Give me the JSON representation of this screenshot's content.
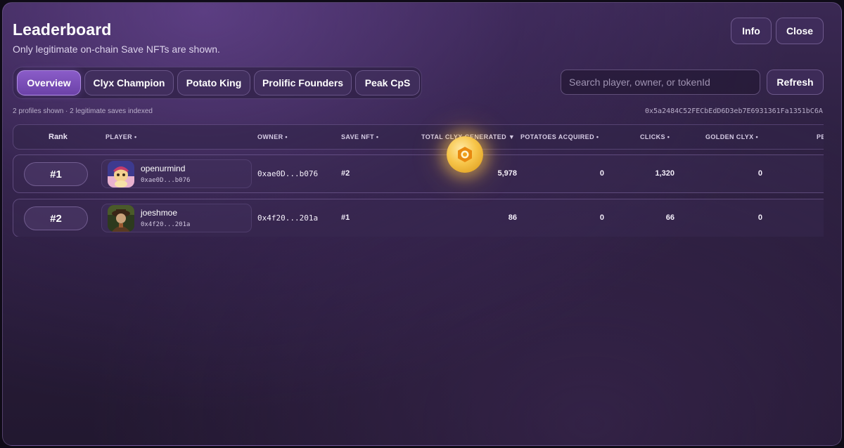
{
  "header": {
    "title": "Leaderboard",
    "subtitle": "Only legitimate on-chain Save NFTs are shown.",
    "info_label": "Info",
    "close_label": "Close"
  },
  "tabs": [
    {
      "label": "Overview",
      "active": true
    },
    {
      "label": "Clyx Champion",
      "active": false
    },
    {
      "label": "Potato King",
      "active": false
    },
    {
      "label": "Prolific Founders",
      "active": false
    },
    {
      "label": "Peak CpS",
      "active": false
    }
  ],
  "search": {
    "placeholder": "Search player, owner, or tokenId",
    "value": ""
  },
  "refresh_label": "Refresh",
  "meta": {
    "summary": "2 profiles shown · 2 legitimate saves indexed",
    "contract": "0x5a2484C52FECbEdD6D3eb7E6931361Fa1351bC6A"
  },
  "table": {
    "columns": {
      "rank": "Rank",
      "player": "PLAYER •",
      "owner": "OWNER •",
      "save_nft": "SAVE NFT •",
      "total": "TOTAL CLYX GENERATED ▼",
      "potatoes": "POTATOES ACQUIRED •",
      "clicks": "CLICKS •",
      "golden": "GOLDEN CLYX •",
      "next": "PE"
    },
    "rows": [
      {
        "rank": "#1",
        "name": "openurmind",
        "player_addr": "0xae0D...b076",
        "owner": "0xae0D...b076",
        "save_nft": "#2",
        "total": "5,978",
        "potatoes": "0",
        "clicks": "1,320",
        "golden": "0"
      },
      {
        "rank": "#2",
        "name": "joeshmoe",
        "player_addr": "0x4f20...201a",
        "owner": "0x4f20...201a",
        "save_nft": "#1",
        "total": "86",
        "potatoes": "0",
        "clicks": "66",
        "golden": "0"
      }
    ]
  },
  "colors": {
    "accent": "#7a4fba",
    "coin": "#f7c54a",
    "background": "#2e2142"
  },
  "icons": {
    "coin": "golden-clyx-coin-icon"
  }
}
